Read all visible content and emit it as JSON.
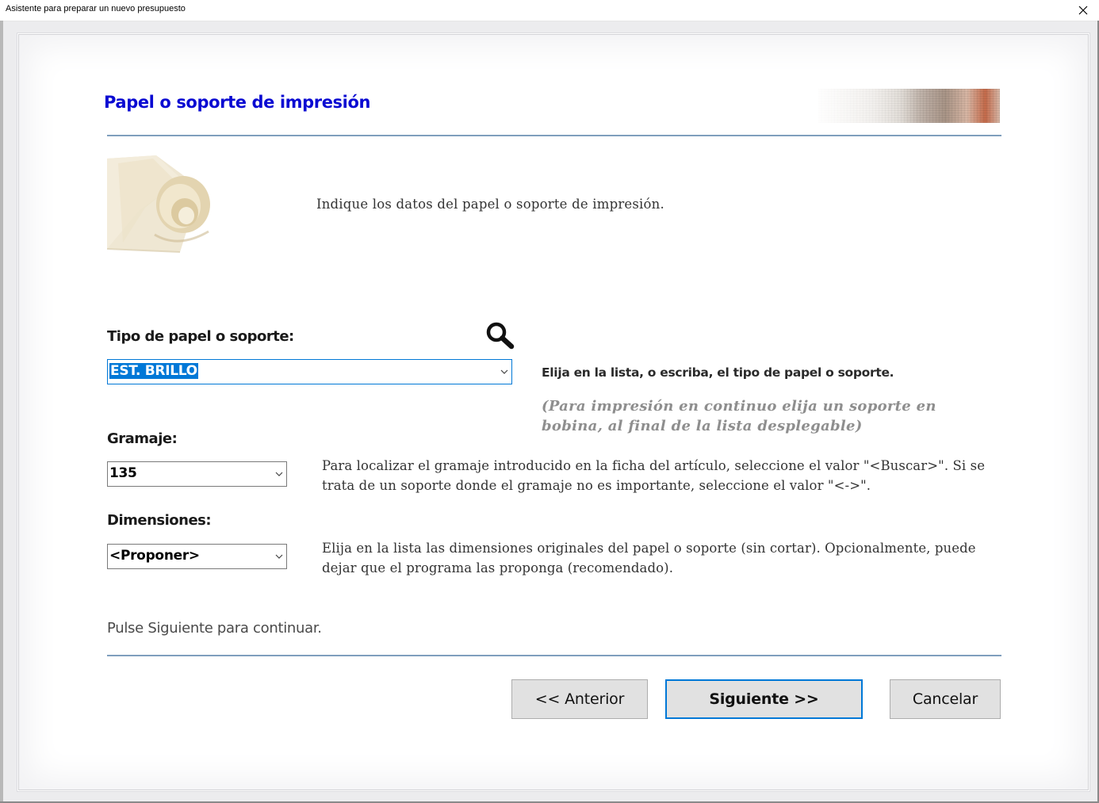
{
  "window": {
    "title": "Asistente para preparar un nuevo presupuesto",
    "close_symbol": "✕"
  },
  "header": {
    "title": "Papel o soporte de impresión",
    "title_color": "#0a0ad2",
    "banner_icon": "paper-texture-banner"
  },
  "intro": {
    "image": "rolled-paper-image",
    "text": "Indique los datos del papel o soporte de impresión."
  },
  "paper_type": {
    "label": "Tipo de papel o soporte:",
    "value": "EST. BRILLO",
    "search_icon": "search-icon",
    "hint": "Elija en la lista, o escriba, el tipo de papel o soporte.",
    "note": "(Para impresión en continuo elija un soporte en bobina, al final de la lista desplegable)"
  },
  "weight": {
    "label": "Gramaje:",
    "value": "135",
    "description": "Para localizar el gramaje introducido en la ficha del artículo, seleccione el valor \"<Buscar>\". Si se trata de un soporte donde el gramaje no es importante, seleccione el valor \"<->\"."
  },
  "dimensions": {
    "label": "Dimensiones:",
    "value": "<Proponer>",
    "description": "Elija en la lista las dimensiones originales del papel o soporte (sin cortar). Opcionalmente, puede dejar que el programa las proponga (recomendado)."
  },
  "footer": {
    "instruction": "Pulse Siguiente para continuar."
  },
  "buttons": {
    "previous": "<< Anterior",
    "next": "Siguiente >>",
    "cancel": "Cancelar"
  },
  "colors": {
    "accent": "#0078d7",
    "rule": "#7f9fbd"
  }
}
